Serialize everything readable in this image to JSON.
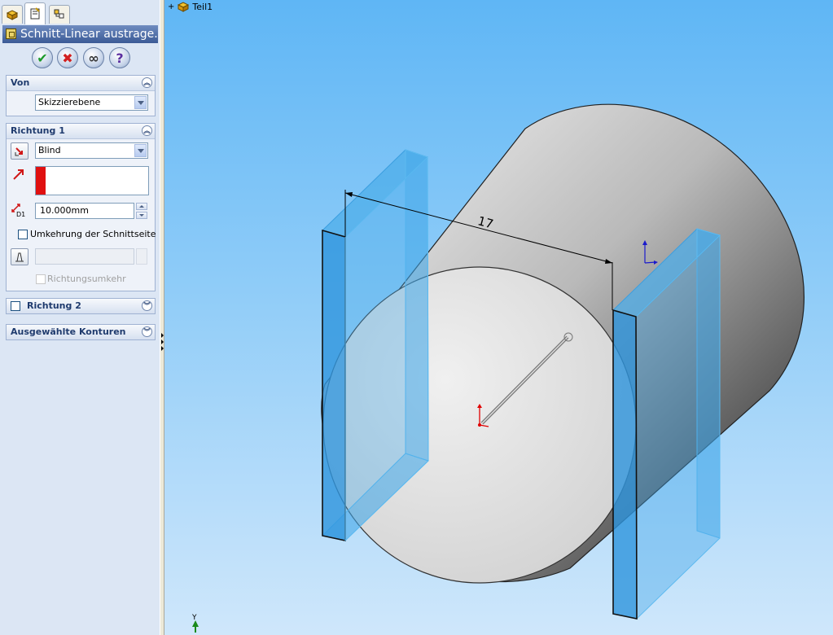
{
  "feature_manager": {
    "tabs": [
      "feature-tree-tab",
      "property-manager-tab",
      "configuration-tab"
    ],
    "title": "Schnitt-Linear austrage...",
    "actions": {
      "ok": "✔",
      "cancel": "✖",
      "preview": "∞",
      "help": "?"
    }
  },
  "von": {
    "header": "Von",
    "start_condition": "Skizzierebene"
  },
  "richtung1": {
    "header": "Richtung 1",
    "end_condition": "Blind",
    "depth": "10.000mm",
    "depth_icon_label": "D1",
    "flip_side_to_cut_label": "Umkehrung der Schnittseite",
    "draft_angle_value": "",
    "draft_outward_label": "Richtungsumkehr"
  },
  "richtung2": {
    "header": "Richtung 2"
  },
  "contours": {
    "header": "Ausgewählte Konturen"
  },
  "graphics": {
    "tree_root_label": "Teil1",
    "dimension_value": "17",
    "triad_y_label": "Y",
    "colors": {
      "viewport_top": "#5fb6f5",
      "viewport_bottom": "#cfe7fb",
      "preview_fill": "#3ea5e8",
      "sketch_point": "#e00000"
    }
  }
}
